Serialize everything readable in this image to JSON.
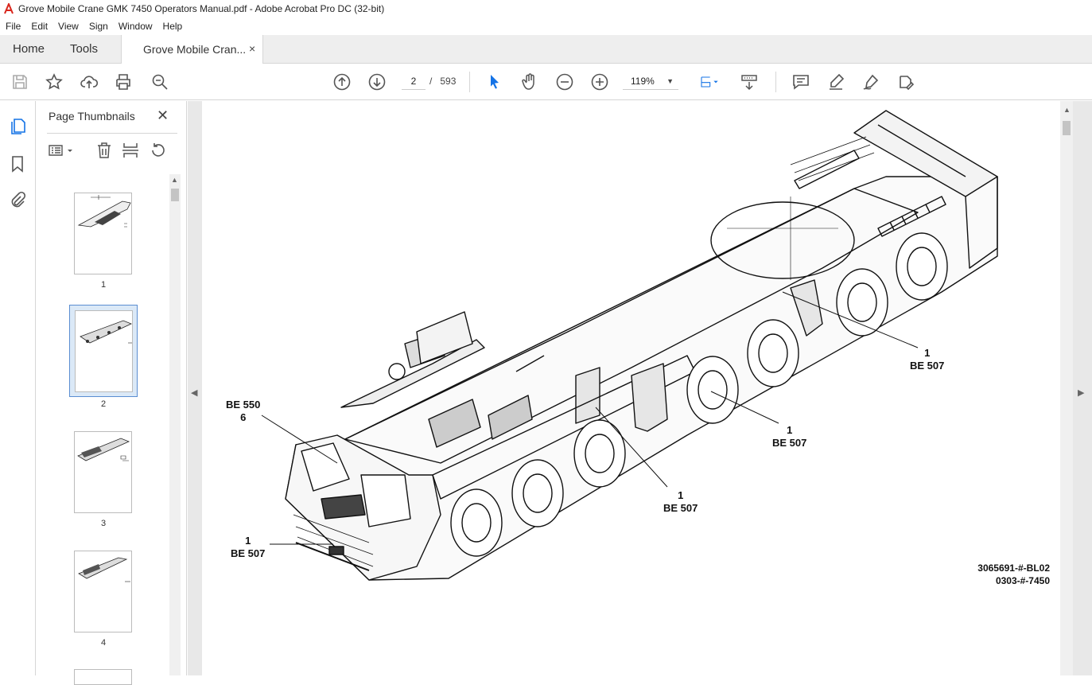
{
  "window": {
    "title": "Grove Mobile Crane GMK 7450 Operators Manual.pdf - Adobe Acrobat Pro DC (32-bit)"
  },
  "menu": [
    "File",
    "Edit",
    "View",
    "Sign",
    "Window",
    "Help"
  ],
  "tabs": {
    "home": "Home",
    "tools": "Tools",
    "document": "Grove Mobile Cran...",
    "close": "×"
  },
  "toolbar": {
    "page_current": "2",
    "page_sep": "/",
    "page_total": "593",
    "zoom": "119%"
  },
  "panel": {
    "title": "Page Thumbnails",
    "close": "✕",
    "thumbnails": [
      {
        "label": "1"
      },
      {
        "label": "2"
      },
      {
        "label": "3"
      },
      {
        "label": "4"
      }
    ]
  },
  "drawing": {
    "callouts": [
      {
        "num": "1",
        "ref": "BE 507"
      },
      {
        "num": "1",
        "ref": "BE 507"
      },
      {
        "num": "1",
        "ref": "BE 507"
      },
      {
        "num": "6",
        "ref": "BE 550"
      },
      {
        "num": "1",
        "ref": "BE 507"
      }
    ],
    "ref_code_1": "3065691-#-BL02",
    "ref_code_2": "0303-#-7450"
  },
  "colors": {
    "accent": "#1473e6",
    "chrome": "#eeeeee",
    "selected_thumb": "#dbe9f7"
  }
}
